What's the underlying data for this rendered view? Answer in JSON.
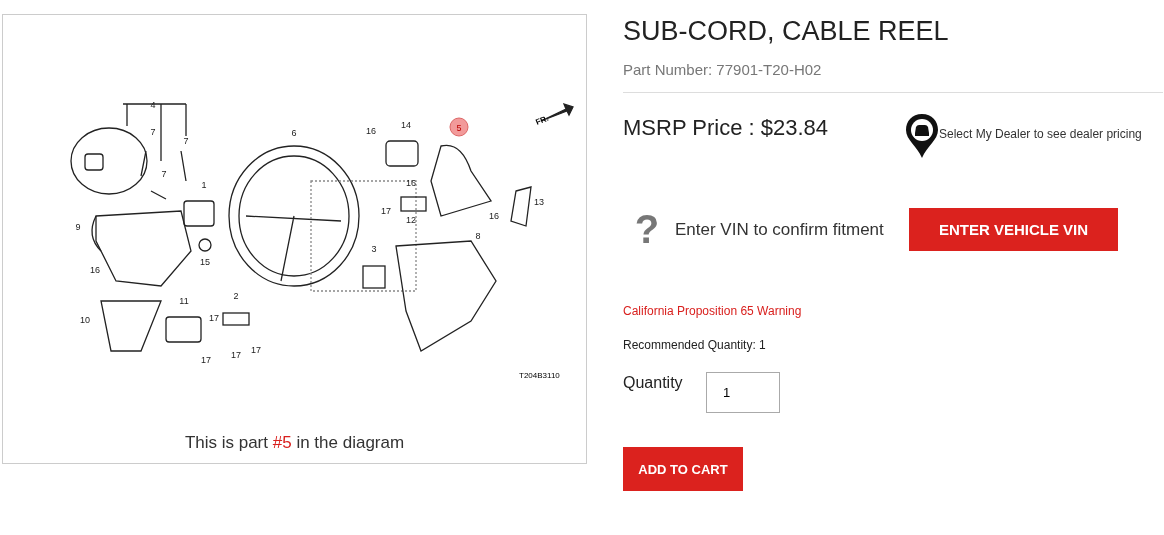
{
  "diagram": {
    "callouts": [
      {
        "label": "4",
        "highlighted": false
      },
      {
        "label": "7",
        "highlighted": false
      },
      {
        "label": "7",
        "highlighted": false
      },
      {
        "label": "7",
        "highlighted": false
      },
      {
        "label": "6",
        "highlighted": false
      },
      {
        "label": "1",
        "highlighted": false
      },
      {
        "label": "9",
        "highlighted": false
      },
      {
        "label": "16",
        "highlighted": false
      },
      {
        "label": "15",
        "highlighted": false
      },
      {
        "label": "11",
        "highlighted": false
      },
      {
        "label": "2",
        "highlighted": false
      },
      {
        "label": "10",
        "highlighted": false
      },
      {
        "label": "17",
        "highlighted": false
      },
      {
        "label": "17",
        "highlighted": false
      },
      {
        "label": "17",
        "highlighted": false
      },
      {
        "label": "17",
        "highlighted": false
      },
      {
        "label": "16",
        "highlighted": false
      },
      {
        "label": "14",
        "highlighted": false
      },
      {
        "label": "5",
        "highlighted": true
      },
      {
        "label": "16",
        "highlighted": false
      },
      {
        "label": "17",
        "highlighted": false
      },
      {
        "label": "12",
        "highlighted": false
      },
      {
        "label": "13",
        "highlighted": false
      },
      {
        "label": "16",
        "highlighted": false
      },
      {
        "label": "3",
        "highlighted": false
      },
      {
        "label": "8",
        "highlighted": false
      }
    ],
    "direction_label": "FR.",
    "drawing_code": "T204B3110",
    "caption": "This is part **#5** in the diagram"
  },
  "product": {
    "title": "SUB-CORD, CABLE REEL",
    "part_number": "Part Number: 77901-T20-H02",
    "price": "MSRP Price : $23.84",
    "dealer_note": "Select My Dealer to see dealer pricing",
    "vin_help": "?",
    "vin_prompt": "Enter VIN to confirm fitment",
    "vin_button": "ENTER VEHICLE VIN",
    "warning": "California Proposition 65 Warning",
    "recommended": "Recommended Quantity: 1",
    "quantity_label": "Quantity",
    "quantity": "1",
    "add_button": "ADD TO CART"
  }
}
